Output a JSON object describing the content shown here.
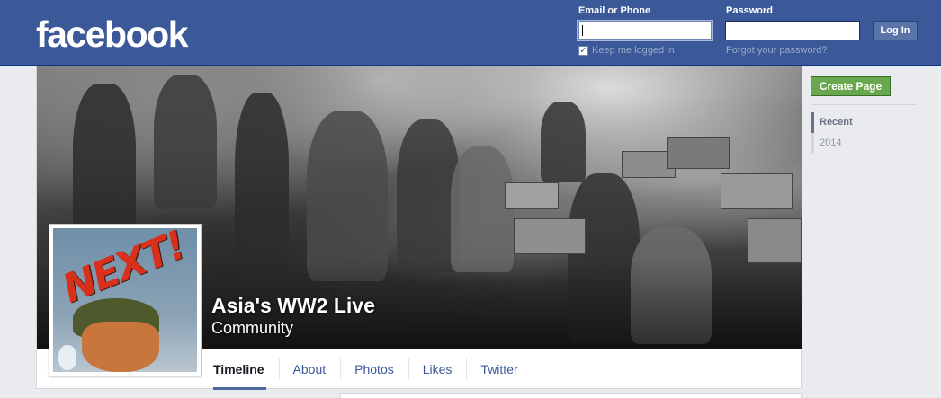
{
  "header": {
    "logo": "facebook",
    "email_label": "Email or Phone",
    "email_value": "",
    "password_label": "Password",
    "password_value": "",
    "login_button": "Log In",
    "keep_logged_in": "Keep me logged in",
    "keep_logged_in_checked": true,
    "forgot_password": "Forgot your password?"
  },
  "page": {
    "name": "Asia's WW2 Live",
    "category": "Community",
    "profile_picture_text": "NEXT!"
  },
  "tabs": [
    {
      "label": "Timeline",
      "active": true
    },
    {
      "label": "About",
      "active": false
    },
    {
      "label": "Photos",
      "active": false
    },
    {
      "label": "Likes",
      "active": false
    },
    {
      "label": "Twitter",
      "active": false
    }
  ],
  "sidebar": {
    "create_page_button": "Create Page",
    "years": [
      {
        "label": "Recent",
        "selected": true
      },
      {
        "label": "2014",
        "selected": false
      }
    ]
  },
  "colors": {
    "brand_blue": "#3b5998",
    "create_green": "#69a74e",
    "background": "#e9ebee"
  }
}
